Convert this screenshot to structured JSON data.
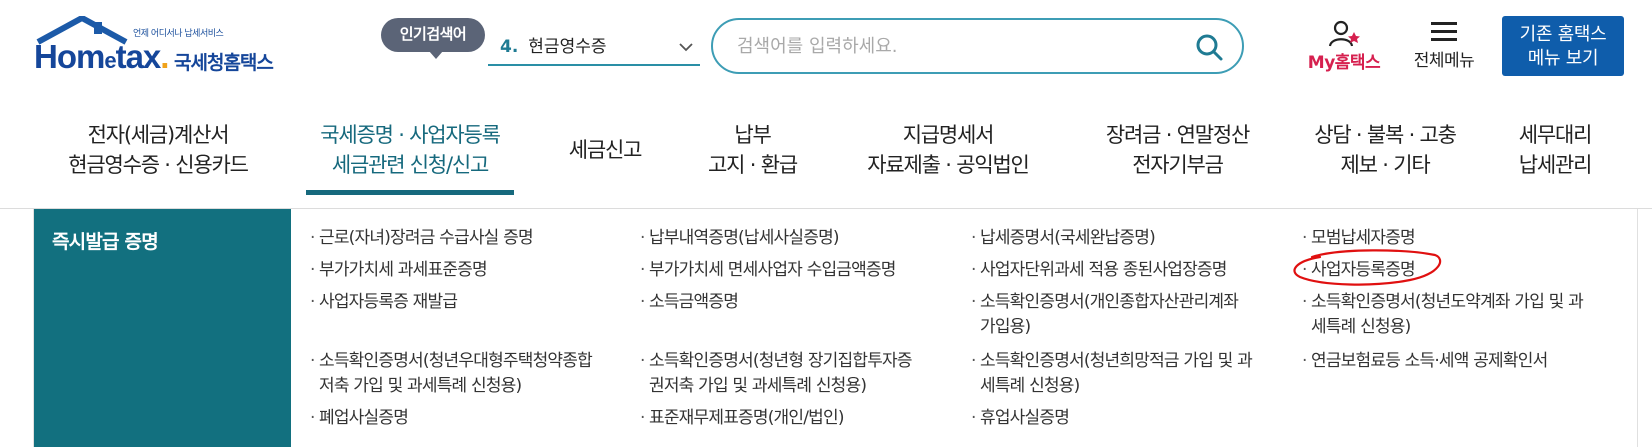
{
  "header": {
    "logo": {
      "tagline": "언제 어디서나 납세서비스",
      "brand": "Hometax",
      "org": "국세청홈택스"
    },
    "popular_search": {
      "badge": "인기검색어",
      "rank": "4.",
      "keyword": "현금영수증"
    },
    "search": {
      "placeholder": "검색어를 입력하세요."
    },
    "my_hometax": "My홈택스",
    "all_menu": "전체메뉴",
    "old_site": {
      "line1": "기존 홈택스",
      "line2": "메뉴 보기"
    }
  },
  "gnb": [
    {
      "line1": "전자(세금)계산서",
      "line2": "현금영수증 · 신용카드"
    },
    {
      "line1": "국세증명 · 사업자등록",
      "line2": "세금관련 신청/신고",
      "active": true
    },
    {
      "line1": "세금신고",
      "line2": ""
    },
    {
      "line1": "납부",
      "line2": "고지 · 환급"
    },
    {
      "line1": "지급명세서",
      "line2": "자료제출 · 공익법인"
    },
    {
      "line1": "장려금 · 연말정산",
      "line2": "전자기부금"
    },
    {
      "line1": "상담 · 불복 · 고충",
      "line2": "제보 · 기타"
    },
    {
      "line1": "세무대리",
      "line2": "납세관리"
    }
  ],
  "submenu": {
    "title": "즉시발급 증명",
    "columns": [
      [
        "근로(자녀)장려금 수급사실 증명",
        "부가가치세 과세표준증명",
        "사업자등록증 재발급",
        "소득확인증명서(청년우대형주택청약종합|저축 가입 및 과세특례 신청용)",
        "폐업사실증명"
      ],
      [
        "납부내역증명(납세사실증명)",
        "부가가치세 면세사업자 수입금액증명",
        "소득금액증명",
        "소득확인증명서(청년형 장기집합투자증|권저축 가입 및 과세특례 신청용)",
        "표준재무제표증명(개인/법인)"
      ],
      [
        "납세증명서(국세완납증명)",
        "사업자단위과세 적용 종된사업장증명",
        "소득확인증명서(개인종합자산관리계좌|가입용)",
        "소득확인증명서(청년희망적금 가입 및 과|세특례 신청용)",
        "휴업사실증명"
      ],
      [
        "모범납세자증명",
        "사업자등록증명",
        "소득확인증명서(청년도약계좌 가입 및 과|세특례 신청용)",
        "연금보험료등 소득·세액 공제확인서"
      ]
    ]
  },
  "colors": {
    "brand": "#15469a",
    "accent": "#16697d",
    "side_bg": "#12707f",
    "search_border": "#3d9db5",
    "old_site_bg": "#0f5dab",
    "annotation": "#e01010"
  }
}
